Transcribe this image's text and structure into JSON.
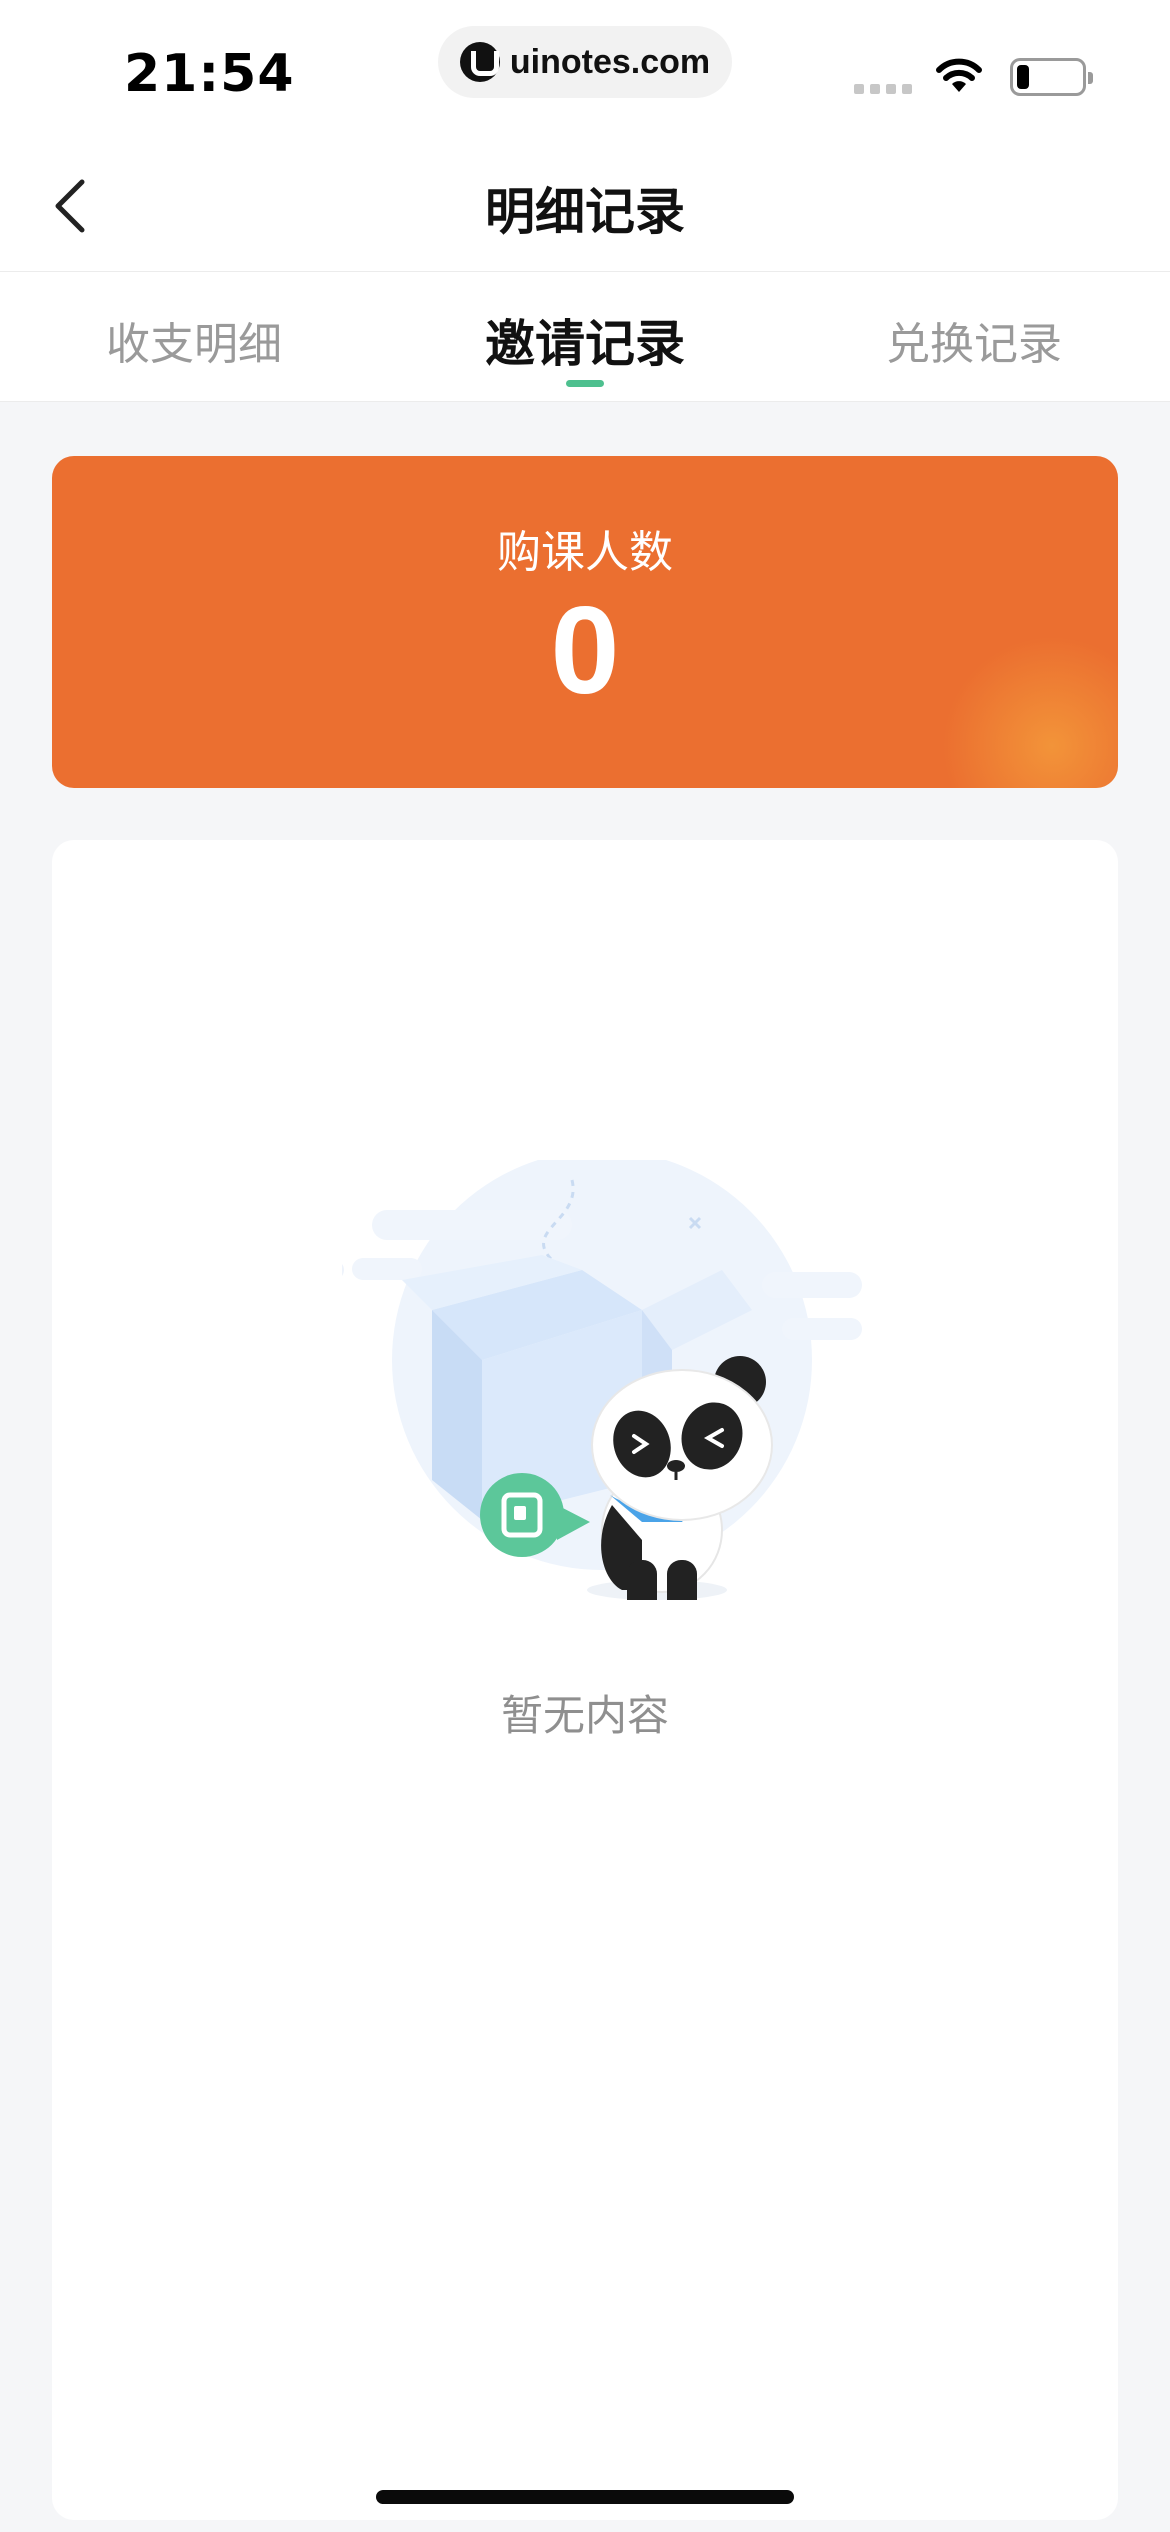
{
  "status_bar": {
    "time": "21:54",
    "url": "uinotes.com"
  },
  "nav": {
    "title": "明细记录"
  },
  "tabs": [
    {
      "label": "收支明细",
      "active": false
    },
    {
      "label": "邀请记录",
      "active": true
    },
    {
      "label": "兑换记录",
      "active": false
    }
  ],
  "stat_card": {
    "label": "购课人数",
    "value": "0",
    "color": "#eb6f30"
  },
  "empty_state": {
    "text": "暂无内容",
    "icon": "panda-empty-box-illustration"
  },
  "colors": {
    "accent": "#4ec08f",
    "background": "#f5f6f8"
  }
}
